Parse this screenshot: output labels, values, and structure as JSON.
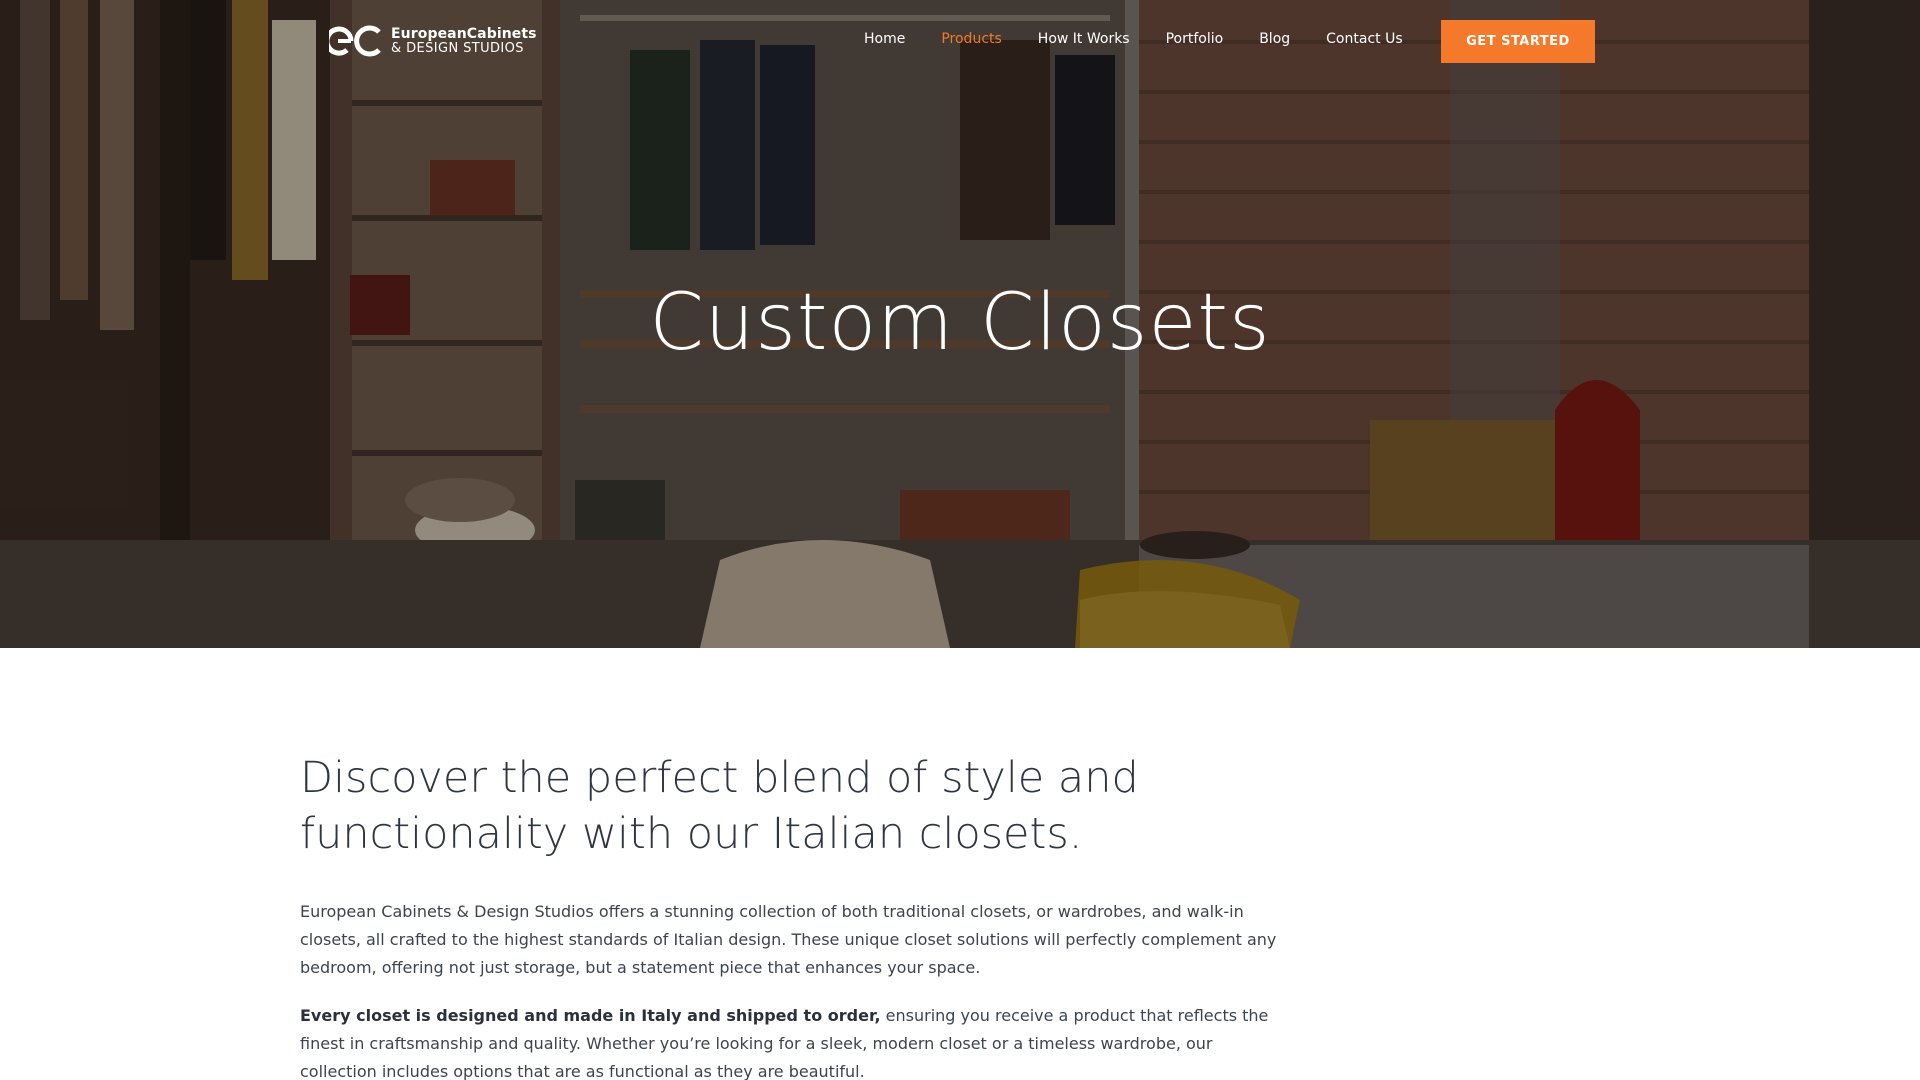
{
  "logo": {
    "line1": "EuropeanCabinets",
    "line2": "& DESIGN STUDIOS"
  },
  "nav": {
    "items": [
      {
        "label": "Home",
        "active": false
      },
      {
        "label": "Products",
        "active": true
      },
      {
        "label": "How It Works",
        "active": false
      },
      {
        "label": "Portfolio",
        "active": false
      },
      {
        "label": "Blog",
        "active": false
      },
      {
        "label": "Contact Us",
        "active": false
      }
    ],
    "cta_label": "GET STARTED"
  },
  "hero": {
    "title": "Custom Closets"
  },
  "content": {
    "headline": "Discover the perfect blend of style and functionality with our Italian closets.",
    "paragraph1": "European Cabinets & Design Studios offers a stunning collection of both traditional closets, or wardrobes, and walk-in closets, all crafted to the highest standards of Italian design. These unique closet solutions will perfectly complement any bedroom, offering not just storage, but a statement piece that enhances your space.",
    "paragraph2_bold": "Every closet is designed and made in Italy and shipped to order,",
    "paragraph2_rest": " ensuring you receive a product that reflects the finest in craftsmanship and quality. Whether you’re looking for a sleek, modern closet or a timeless wardrobe, our collection includes options that are as functional as they are beautiful."
  },
  "colors": {
    "accent": "#f5792a",
    "text": "#2f3542"
  }
}
